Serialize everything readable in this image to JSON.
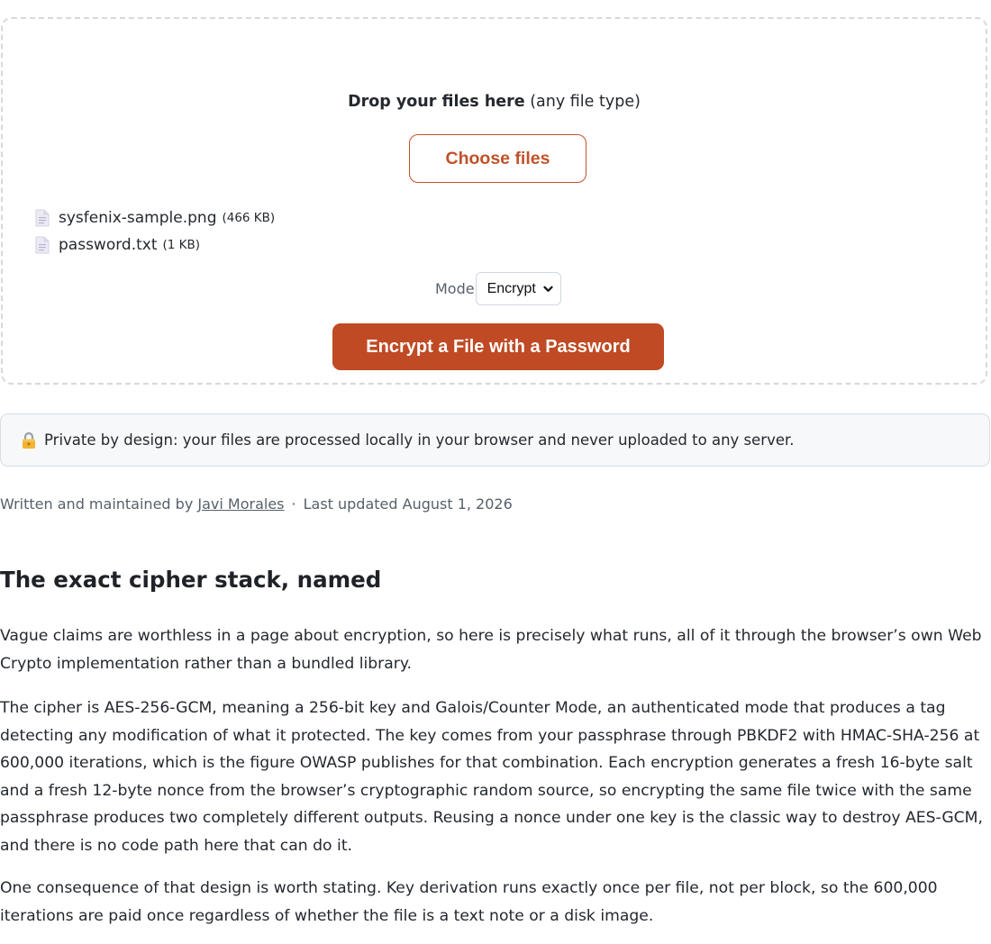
{
  "dropzone": {
    "title_bold": "Drop your files here",
    "title_rest": " (any file type)",
    "choose_label": "Choose files",
    "files": [
      {
        "name": "sysfenix-sample.png",
        "size": "(466 KB)"
      },
      {
        "name": "password.txt",
        "size": "(1 KB)"
      }
    ],
    "mode_label": "Mode",
    "mode_value": "Encrypt",
    "submit_label": "Encrypt a File with a Password"
  },
  "notice": {
    "icon": "lock-icon",
    "text": "Private by design: your files are processed locally in your browser and never uploaded to any server."
  },
  "byline": {
    "prefix": "Written and maintained by ",
    "author": "Javi Morales",
    "separator": "·",
    "updated": "Last updated August 1, 2026"
  },
  "article": {
    "heading": "The exact cipher stack, named",
    "paragraphs": [
      "Vague claims are worthless in a page about encryption, so here is precisely what runs, all of it through the browser’s own Web Crypto implementation rather than a bundled library.",
      "The cipher is AES-256-GCM, meaning a 256-bit key and Galois/Counter Mode, an authenticated mode that produces a tag detecting any modification of what it protected. The key comes from your passphrase through PBKDF2 with HMAC-SHA-256 at 600,000 iterations, which is the figure OWASP publishes for that combination. Each encryption generates a fresh 16-byte salt and a fresh 12-byte nonce from the browser’s cryptographic random source, so encrypting the same file twice with the same passphrase produces two completely different outputs. Reusing a nonce under one key is the classic way to destroy AES-GCM, and there is no code path here that can do it.",
      "One consequence of that design is worth stating. Key derivation runs exactly once per file, not per block, so the 600,000 iterations are paid once regardless of whether the file is a text note or a disk image."
    ]
  },
  "colors": {
    "accent": "#bf4a24",
    "accent_outline": "#c0522a",
    "notice_bg": "#f6f8fa"
  }
}
